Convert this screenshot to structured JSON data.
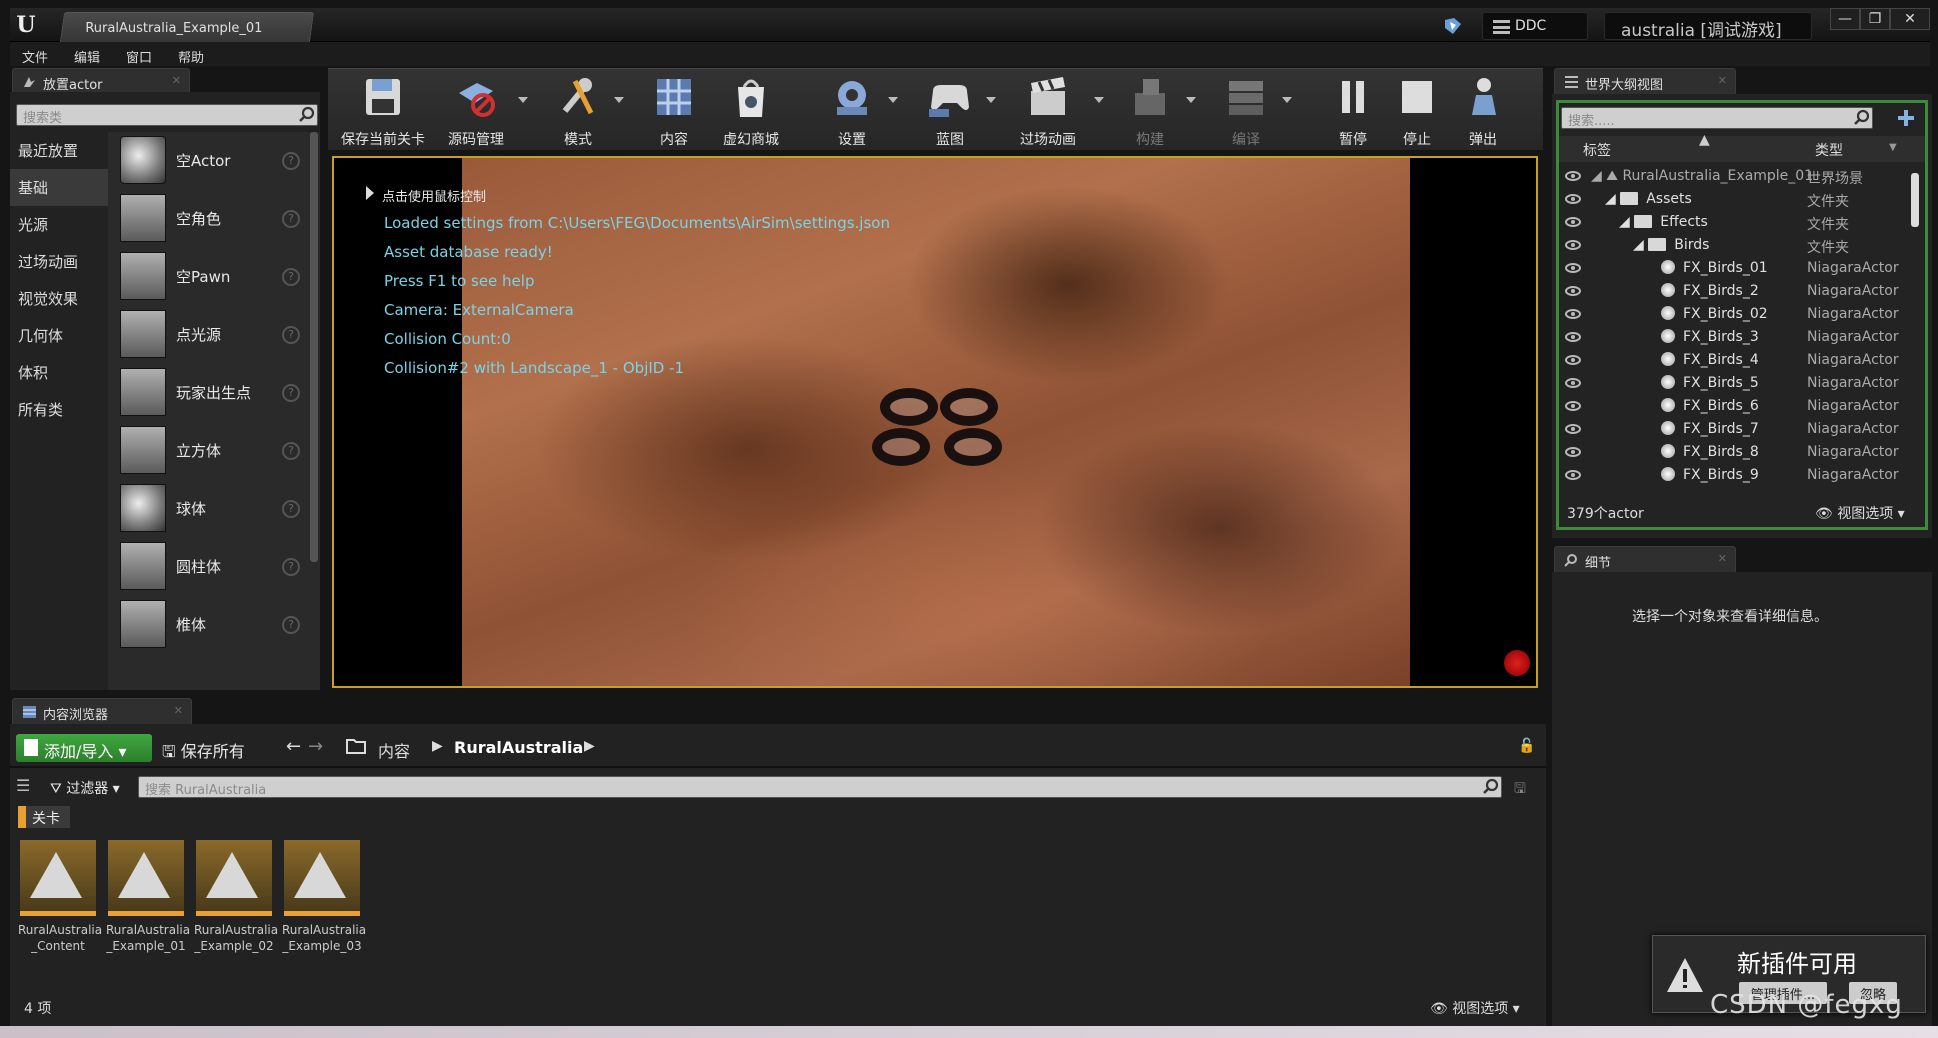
{
  "titlebar": {
    "tab_title": "RuralAustralia_Example_01",
    "ddc_label": "DDC",
    "project_label": "australia [调试游戏]",
    "minimize": "—",
    "restore": "❐",
    "close": "✕"
  },
  "menu": [
    "文件",
    "编辑",
    "窗口",
    "帮助"
  ],
  "place_actor": {
    "tab": "放置actor",
    "search_placeholder": "搜索类",
    "categories": [
      "最近放置",
      "基础",
      "光源",
      "过场动画",
      "视觉效果",
      "几何体",
      "体积",
      "所有类"
    ],
    "items": [
      "空Actor",
      "空角色",
      "空Pawn",
      "点光源",
      "玩家出生点",
      "立方体",
      "球体",
      "圆柱体",
      "椎体"
    ],
    "help_glyph": "?"
  },
  "toolbar": {
    "save": "保存当前关卡",
    "source": "源码管理",
    "modes": "模式",
    "content": "内容",
    "market": "虚幻商城",
    "settings": "设置",
    "blueprints": "蓝图",
    "cinematics": "过场动画",
    "build": "构建",
    "compile": "编译",
    "pause": "暂停",
    "stop": "停止",
    "eject": "弹出"
  },
  "viewport": {
    "hint": "点击使用鼠标控制",
    "messages": [
      "Loaded settings from C:\\Users\\FEG\\Documents\\AirSim\\settings.json",
      "Asset database ready!",
      "Press F1 to see help",
      "Camera: ExternalCamera",
      "Collision Count:0",
      "Collision#2 with Landscape_1 - ObjID -1"
    ]
  },
  "outliner": {
    "tab": "世界大纲视图",
    "search_placeholder": "搜索.....",
    "col_label": "标签",
    "col_type": "类型",
    "rows": [
      {
        "name": "RuralAustralia_Example_01",
        "type": "世界场景",
        "depth": 0,
        "icon": "world"
      },
      {
        "name": "Assets",
        "type": "文件夹",
        "depth": 1,
        "icon": "folder"
      },
      {
        "name": "Effects",
        "type": "文件夹",
        "depth": 2,
        "icon": "folder"
      },
      {
        "name": "Birds",
        "type": "文件夹",
        "depth": 3,
        "icon": "folder"
      },
      {
        "name": "FX_Birds_01",
        "type": "NiagaraActor",
        "depth": 4,
        "icon": "ball"
      },
      {
        "name": "FX_Birds_2",
        "type": "NiagaraActor",
        "depth": 4,
        "icon": "ball"
      },
      {
        "name": "FX_Birds_02",
        "type": "NiagaraActor",
        "depth": 4,
        "icon": "ball"
      },
      {
        "name": "FX_Birds_3",
        "type": "NiagaraActor",
        "depth": 4,
        "icon": "ball"
      },
      {
        "name": "FX_Birds_4",
        "type": "NiagaraActor",
        "depth": 4,
        "icon": "ball"
      },
      {
        "name": "FX_Birds_5",
        "type": "NiagaraActor",
        "depth": 4,
        "icon": "ball"
      },
      {
        "name": "FX_Birds_6",
        "type": "NiagaraActor",
        "depth": 4,
        "icon": "ball"
      },
      {
        "name": "FX_Birds_7",
        "type": "NiagaraActor",
        "depth": 4,
        "icon": "ball"
      },
      {
        "name": "FX_Birds_8",
        "type": "NiagaraActor",
        "depth": 4,
        "icon": "ball"
      },
      {
        "name": "FX_Birds_9",
        "type": "NiagaraActor",
        "depth": 4,
        "icon": "ball"
      }
    ],
    "count": "379个actor",
    "view_options": "视图选项"
  },
  "details": {
    "tab": "细节",
    "empty_text": "选择一个对象来查看详细信息。"
  },
  "content_browser": {
    "tab": "内容浏览器",
    "add_import": "添加/导入",
    "save_all": "保存所有",
    "path_root": "内容",
    "path_folder": "RuralAustralia",
    "filters": "过滤器",
    "search_placeholder": "搜索 RuralAustralia",
    "filter_tag": "关卡",
    "assets": [
      [
        "RuralAustralia",
        "_Content"
      ],
      [
        "RuralAustralia",
        "_Example_01"
      ],
      [
        "RuralAustralia",
        "_Example_02"
      ],
      [
        "RuralAustralia",
        "_Example_03"
      ]
    ],
    "item_count": "4 项",
    "view_options": "视图选项"
  },
  "notice": {
    "title": "新插件可用",
    "manage": "管理插件...",
    "dismiss": "忽略"
  },
  "watermark": "CSDN @fegxg"
}
